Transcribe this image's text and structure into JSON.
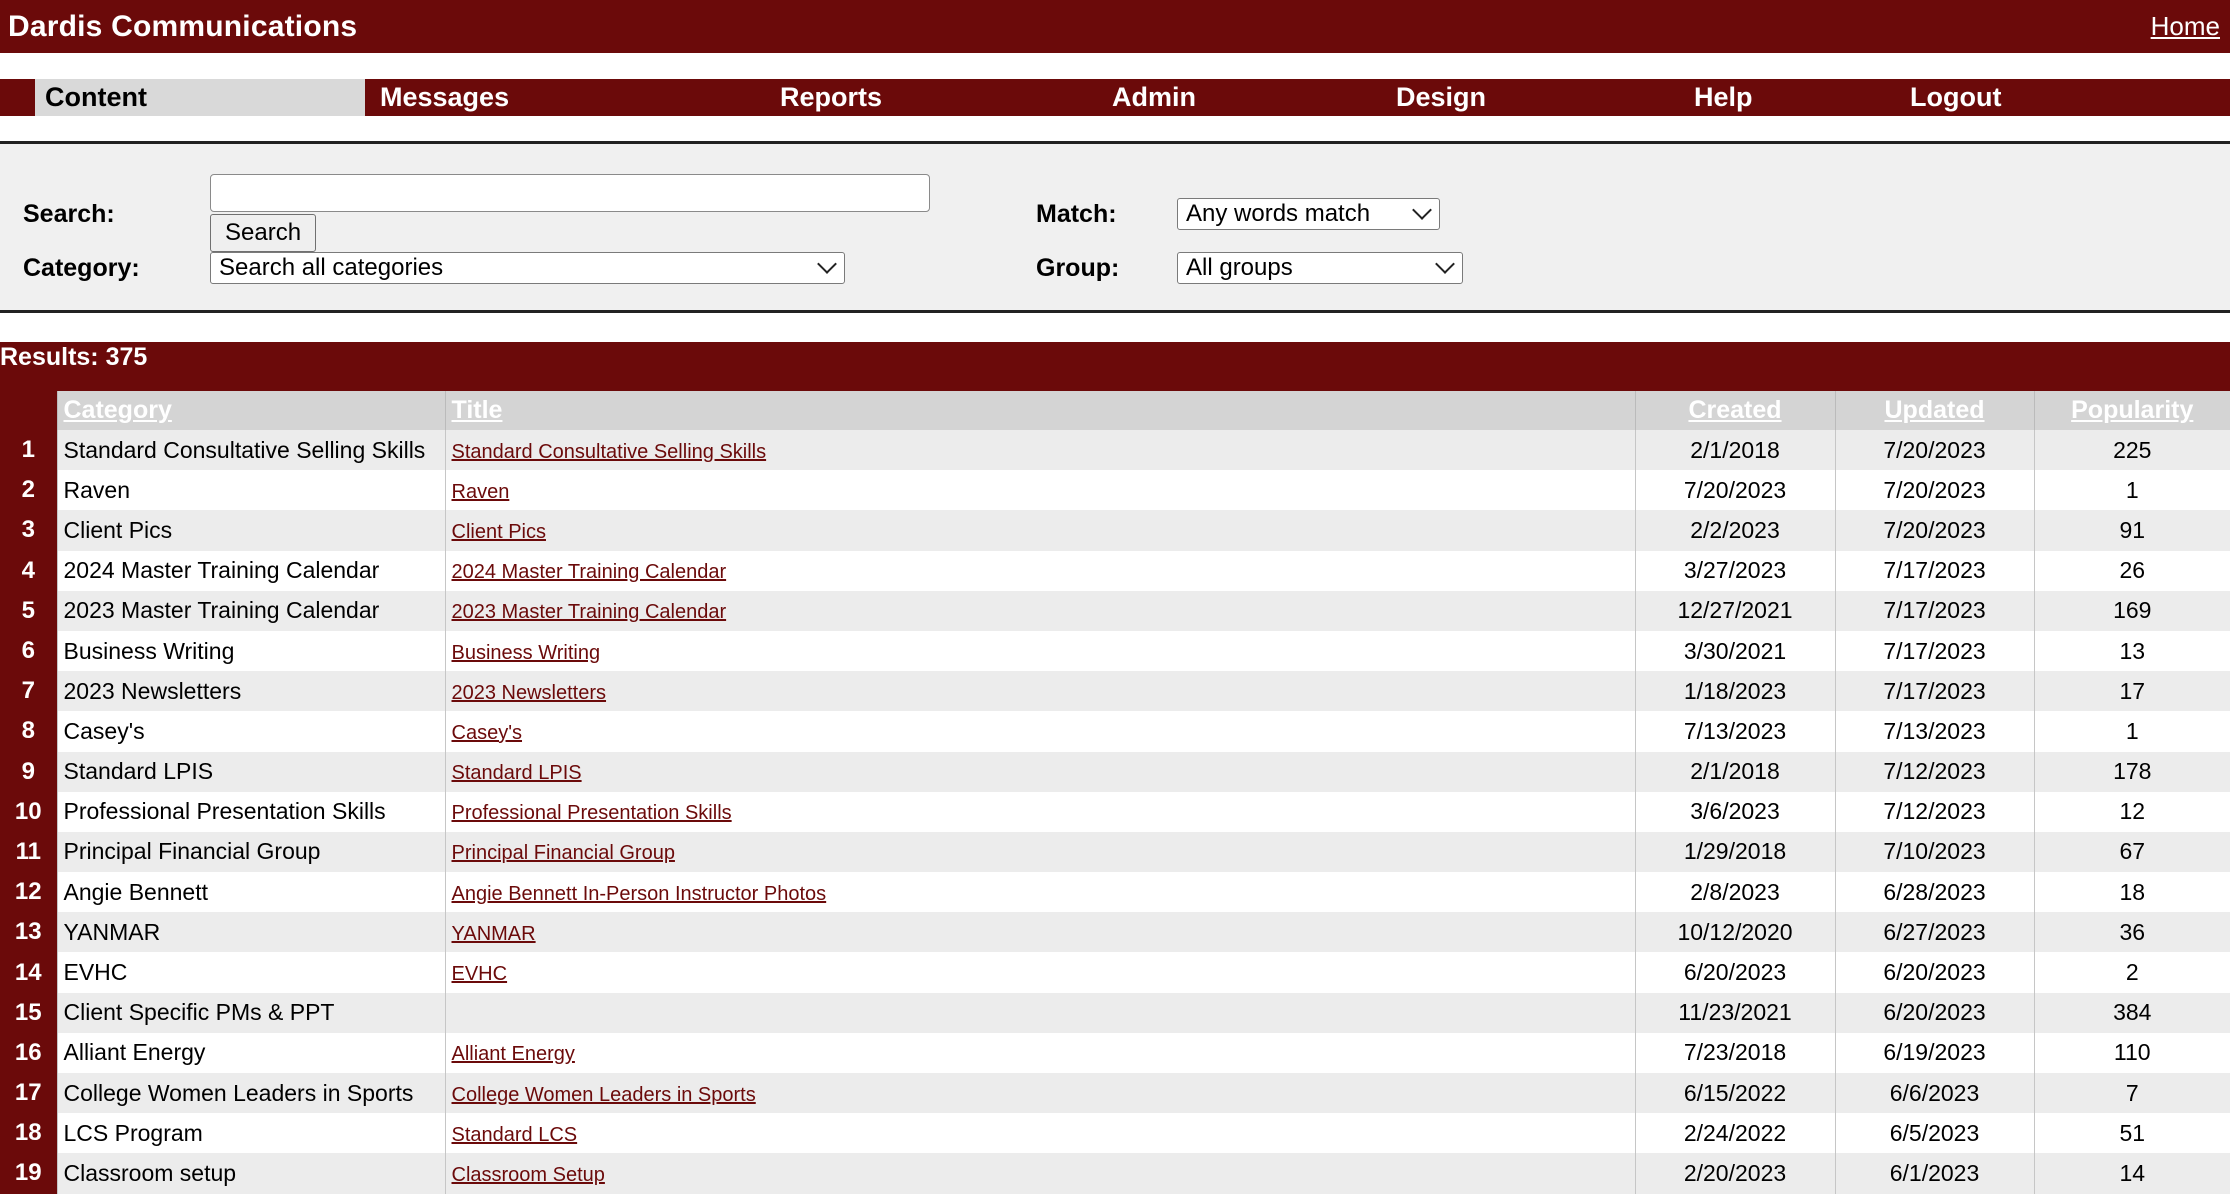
{
  "header": {
    "title": "Dardis Communications",
    "home_link": "Home"
  },
  "nav": {
    "tabs": [
      {
        "label": "Content",
        "active": true
      },
      {
        "label": "Messages"
      },
      {
        "label": "Reports"
      },
      {
        "label": "Admin"
      },
      {
        "label": "Design"
      },
      {
        "label": "Help"
      },
      {
        "label": "Logout"
      }
    ]
  },
  "search": {
    "search_label": "Search:",
    "search_value": "",
    "search_button": "Search",
    "category_label": "Category:",
    "category_selected": "Search all categories",
    "match_label": "Match:",
    "match_selected": "Any words match",
    "group_label": "Group:",
    "group_selected": "All groups"
  },
  "results": {
    "label": "Results: 375",
    "columns": {
      "category": "Category",
      "title": "Title",
      "created": "Created",
      "updated": "Updated",
      "popularity": "Popularity"
    },
    "rows": [
      {
        "n": "1",
        "category": "Standard Consultative Selling Skills",
        "title": "Standard Consultative Selling Skills",
        "created": "2/1/2018",
        "updated": "7/20/2023",
        "popularity": "225"
      },
      {
        "n": "2",
        "category": "Raven",
        "title": "Raven",
        "created": "7/20/2023",
        "updated": "7/20/2023",
        "popularity": "1"
      },
      {
        "n": "3",
        "category": "Client Pics",
        "title": "Client Pics",
        "created": "2/2/2023",
        "updated": "7/20/2023",
        "popularity": "91"
      },
      {
        "n": "4",
        "category": "2024 Master Training Calendar",
        "title": "2024 Master Training Calendar",
        "created": "3/27/2023",
        "updated": "7/17/2023",
        "popularity": "26"
      },
      {
        "n": "5",
        "category": "2023 Master Training Calendar",
        "title": "2023 Master Training Calendar",
        "created": "12/27/2021",
        "updated": "7/17/2023",
        "popularity": "169"
      },
      {
        "n": "6",
        "category": "Business Writing",
        "title": "Business Writing",
        "created": "3/30/2021",
        "updated": "7/17/2023",
        "popularity": "13"
      },
      {
        "n": "7",
        "category": "2023 Newsletters",
        "title": "2023 Newsletters",
        "created": "1/18/2023",
        "updated": "7/17/2023",
        "popularity": "17"
      },
      {
        "n": "8",
        "category": "Casey's",
        "title": "Casey's",
        "created": "7/13/2023",
        "updated": "7/13/2023",
        "popularity": "1"
      },
      {
        "n": "9",
        "category": "Standard LPIS",
        "title": "Standard LPIS",
        "created": "2/1/2018",
        "updated": "7/12/2023",
        "popularity": "178"
      },
      {
        "n": "10",
        "category": "Professional Presentation Skills",
        "title": "Professional Presentation Skills",
        "created": "3/6/2023",
        "updated": "7/12/2023",
        "popularity": "12"
      },
      {
        "n": "11",
        "category": "Principal Financial Group",
        "title": "Principal Financial Group",
        "created": "1/29/2018",
        "updated": "7/10/2023",
        "popularity": "67"
      },
      {
        "n": "12",
        "category": "Angie Bennett",
        "title": "Angie Bennett In-Person Instructor Photos",
        "created": "2/8/2023",
        "updated": "6/28/2023",
        "popularity": "18"
      },
      {
        "n": "13",
        "category": "YANMAR",
        "title": "YANMAR",
        "created": "10/12/2020",
        "updated": "6/27/2023",
        "popularity": "36"
      },
      {
        "n": "14",
        "category": "EVHC",
        "title": "EVHC",
        "created": "6/20/2023",
        "updated": "6/20/2023",
        "popularity": "2"
      },
      {
        "n": "15",
        "category": "Client Specific PMs & PPT",
        "title": "",
        "created": "11/23/2021",
        "updated": "6/20/2023",
        "popularity": "384"
      },
      {
        "n": "16",
        "category": "Alliant Energy",
        "title": "Alliant Energy",
        "created": "7/23/2018",
        "updated": "6/19/2023",
        "popularity": "110"
      },
      {
        "n": "17",
        "category": "College Women Leaders in Sports",
        "title": "College Women Leaders in Sports",
        "created": "6/15/2022",
        "updated": "6/6/2023",
        "popularity": "7"
      },
      {
        "n": "18",
        "category": "LCS Program",
        "title": "Standard LCS",
        "created": "2/24/2022",
        "updated": "6/5/2023",
        "popularity": "51"
      },
      {
        "n": "19",
        "category": "Classroom setup",
        "title": "Classroom Setup",
        "created": "2/20/2023",
        "updated": "6/1/2023",
        "popularity": "14"
      }
    ]
  },
  "colors": {
    "brand": "#6b0a0a",
    "panel": "#f0f0f0",
    "row_alt": "#ececec"
  }
}
